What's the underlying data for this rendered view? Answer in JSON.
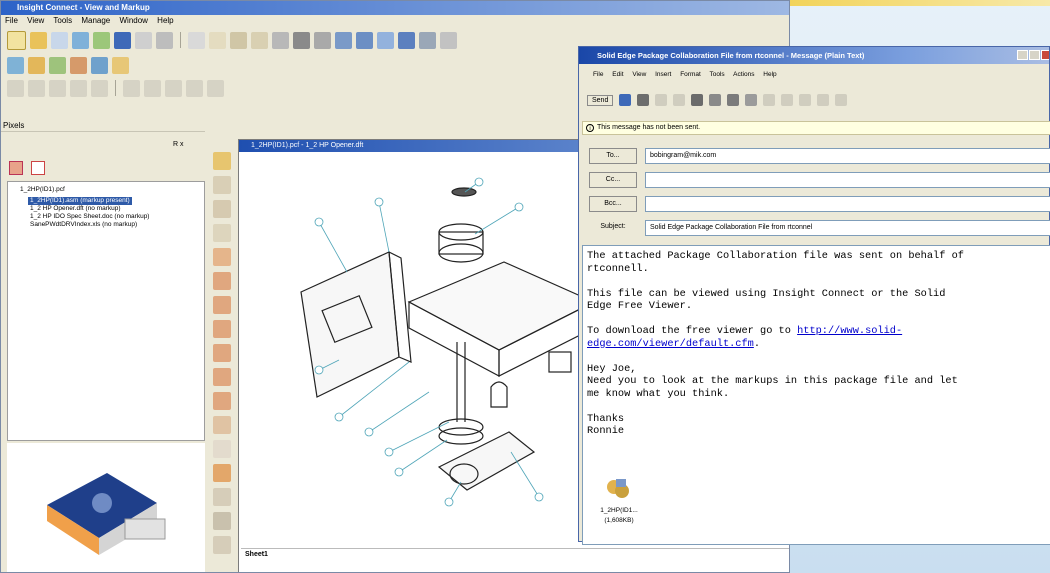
{
  "main_window": {
    "title": "Insight Connect - View and Markup",
    "menu": [
      "File",
      "View",
      "Tools",
      "Manage",
      "Window",
      "Help"
    ],
    "panel_label": "Pixels",
    "panel_pin": "R x",
    "tree_items": [
      "1_2HP(ID1).pcf",
      "1_2HP(ID1).asm (markup present)",
      "1_2 HP Opener.dft (no markup)",
      "1_2 HP IDO Spec Sheet.doc (no markup)",
      "SanePWdtDRVIndex.xls (no markup)"
    ],
    "drawing_window_title": "1_2HP(ID1).pcf - 1_2 HP Opener.dft",
    "sheet_tab": "Sheet1"
  },
  "mail_window": {
    "title": "Solid Edge Package Collaboration File from rtconnel - Message (Plain Text)",
    "menu": [
      "File",
      "Edit",
      "View",
      "Insert",
      "Format",
      "Tools",
      "Actions",
      "Help"
    ],
    "send_label": "Send",
    "notice": "This message has not been sent.",
    "to_label": "To...",
    "to_value": "bobingram@mik.com",
    "cc_label": "Cc...",
    "cc_value": "",
    "bcc_label": "Bcc...",
    "bcc_value": "",
    "subject_label": "Subject:",
    "subject_value": "Solid Edge Package Collaboration File from rtconnel",
    "body_lines": [
      "The attached Package Collaboration file was sent on behalf of",
      "rtconnell.",
      "",
      "This file can be viewed using Insight Connect or the Solid",
      "Edge Free Viewer.",
      "",
      "To download the free viewer go to "
    ],
    "link_part1": "http://www.solid-",
    "link_part2": "edge.com/viewer/default.cfm",
    "link_tail": ".",
    "body_lines_2": [
      "",
      "Hey Joe,",
      "Need you to look at the markups in this package file and let",
      "me know what you think.",
      "",
      "Thanks",
      "Ronnie"
    ],
    "attachment_name": "1_2HP(ID1...",
    "attachment_size": "(1,608KB)"
  },
  "colors": {
    "main_title": "#2d63c8",
    "mail_title": "#1a47a8",
    "selection": "#2e5aa8",
    "notice_bg": "#ffffe1",
    "link": "#0000cc"
  }
}
